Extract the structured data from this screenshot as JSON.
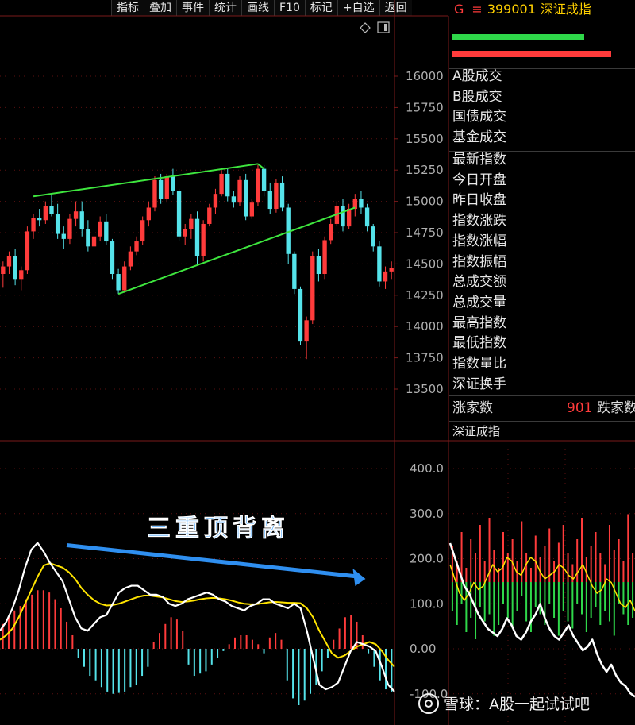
{
  "toolbar": {
    "buttons": [
      "指标",
      "叠加",
      "事件",
      "统计",
      "画线",
      "F10",
      "标记",
      "+自选",
      "返回"
    ]
  },
  "header": {
    "g": "G",
    "eq": "≡",
    "code": "399001",
    "name": "深证成指"
  },
  "sidebar": {
    "group1": [
      "A股成交",
      "B股成交",
      "国债成交",
      "基金成交"
    ],
    "group2": [
      "最新指数",
      "今日开盘",
      "昨日收盘",
      "指数涨跌",
      "指数涨幅",
      "指数振幅",
      "总成交额",
      "总成交量",
      "最高指数",
      "最低指数",
      "指数量比",
      "深证换手"
    ],
    "up_label": "涨家数",
    "up_value": "901",
    "down_label": "跌家数",
    "sub_title": "深证成指"
  },
  "annotation": "三重顶背离",
  "watermark": "雪球：A股一起试试吧",
  "colors": {
    "up": "#ff3b3b",
    "down": "#55e3ea",
    "trend": "#3ee63e",
    "dif": "#ffffff",
    "dea": "#ffe400",
    "arrow": "#2f8ff0",
    "grid": "#8b1a1a"
  },
  "chart_data": [
    {
      "type": "candlestick",
      "y_ticks": [
        16000,
        15750,
        15500,
        15250,
        15000,
        14750,
        14500,
        14250,
        14000,
        13750,
        13500
      ],
      "ylim": [
        13400,
        16200
      ],
      "ohlc": [
        [
          14420,
          14520,
          14310,
          14480
        ],
        [
          14480,
          14600,
          14420,
          14560
        ],
        [
          14560,
          14620,
          14330,
          14380
        ],
        [
          14380,
          14480,
          14290,
          14450
        ],
        [
          14450,
          14800,
          14420,
          14760
        ],
        [
          14760,
          14900,
          14700,
          14870
        ],
        [
          14870,
          14940,
          14800,
          14850
        ],
        [
          14850,
          15000,
          14820,
          14960
        ],
        [
          14960,
          15060,
          14880,
          14900
        ],
        [
          14900,
          14980,
          14700,
          14740
        ],
        [
          14740,
          14800,
          14620,
          14700
        ],
        [
          14700,
          14900,
          14660,
          14860
        ],
        [
          14860,
          15000,
          14800,
          14920
        ],
        [
          14920,
          15000,
          14720,
          14780
        ],
        [
          14780,
          14850,
          14600,
          14640
        ],
        [
          14640,
          14750,
          14560,
          14720
        ],
        [
          14720,
          14880,
          14680,
          14840
        ],
        [
          14840,
          14900,
          14650,
          14680
        ],
        [
          14680,
          14700,
          14380,
          14420
        ],
        [
          14420,
          14460,
          14260,
          14290
        ],
        [
          14290,
          14520,
          14270,
          14480
        ],
        [
          14480,
          14640,
          14450,
          14600
        ],
        [
          14600,
          14720,
          14570,
          14680
        ],
        [
          14680,
          14880,
          14650,
          14850
        ],
        [
          14850,
          15000,
          14800,
          14950
        ],
        [
          14950,
          15200,
          14920,
          15170
        ],
        [
          15170,
          15220,
          14980,
          15020
        ],
        [
          15020,
          15220,
          14990,
          15200
        ],
        [
          15200,
          15260,
          15050,
          15080
        ],
        [
          15080,
          15100,
          14680,
          14720
        ],
        [
          14720,
          14820,
          14650,
          14780
        ],
        [
          14780,
          14900,
          14700,
          14860
        ],
        [
          14860,
          14920,
          14500,
          14560
        ],
        [
          14560,
          14850,
          14520,
          14820
        ],
        [
          14820,
          14980,
          14800,
          14950
        ],
        [
          14950,
          15100,
          14900,
          15060
        ],
        [
          15060,
          15250,
          15040,
          15220
        ],
        [
          15220,
          15260,
          15000,
          15040
        ],
        [
          15040,
          15080,
          14950,
          14990
        ],
        [
          14990,
          15200,
          14960,
          15170
        ],
        [
          15170,
          15220,
          14850,
          14880
        ],
        [
          14880,
          15020,
          14860,
          14990
        ],
        [
          14990,
          15290,
          14960,
          15260
        ],
        [
          15260,
          15290,
          15040,
          15080
        ],
        [
          15080,
          15150,
          14900,
          14940
        ],
        [
          14940,
          15180,
          14910,
          15150
        ],
        [
          15150,
          15200,
          14920,
          14950
        ],
        [
          14950,
          14980,
          14500,
          14580
        ],
        [
          14580,
          14600,
          14260,
          14300
        ],
        [
          14300,
          14320,
          13850,
          13880
        ],
        [
          13880,
          14080,
          13740,
          14050
        ],
        [
          14050,
          14600,
          14020,
          14560
        ],
        [
          14560,
          14620,
          14360,
          14420
        ],
        [
          14420,
          14720,
          14380,
          14690
        ],
        [
          14690,
          14860,
          14660,
          14820
        ],
        [
          14820,
          15000,
          14800,
          14960
        ],
        [
          14960,
          15020,
          14760,
          14800
        ],
        [
          14800,
          14980,
          14780,
          14940
        ],
        [
          14940,
          15060,
          14880,
          15020
        ],
        [
          15020,
          15080,
          14900,
          14950
        ],
        [
          14950,
          14980,
          14760,
          14800
        ],
        [
          14800,
          14820,
          14600,
          14640
        ],
        [
          14640,
          14680,
          14320,
          14360
        ],
        [
          14360,
          14480,
          14300,
          14440
        ],
        [
          14440,
          14520,
          14380,
          14470
        ]
      ],
      "trendlines": [
        {
          "from": [
            5,
            15040
          ],
          "to": [
            42,
            15300
          ]
        },
        {
          "from": [
            19,
            14260
          ],
          "to": [
            58,
            14950
          ]
        },
        {
          "from": [
            42,
            15300
          ],
          "to": [
            43,
            15260
          ]
        }
      ]
    },
    {
      "type": "macd",
      "y_ticks": [
        400.0,
        300.0,
        200.0,
        100.0,
        0.0,
        -100.0
      ],
      "ylim": [
        -170,
        420
      ],
      "hist": [
        55,
        70,
        85,
        95,
        110,
        120,
        130,
        130,
        125,
        110,
        90,
        60,
        30,
        -20,
        -40,
        -60,
        -70,
        -85,
        -95,
        -100,
        -98,
        -95,
        -85,
        -80,
        -60,
        -40,
        15,
        35,
        55,
        70,
        65,
        40,
        -35,
        -60,
        -55,
        -50,
        -35,
        -20,
        -5,
        10,
        25,
        30,
        30,
        20,
        10,
        -10,
        25,
        35,
        20,
        -70,
        -110,
        -125,
        -115,
        -100,
        -80,
        -50,
        -20,
        20,
        45,
        70,
        75,
        60,
        30,
        -10,
        -40,
        -70,
        -90,
        -95
      ],
      "dif": [
        40,
        60,
        90,
        130,
        180,
        220,
        235,
        215,
        190,
        170,
        150,
        110,
        70,
        45,
        40,
        55,
        70,
        75,
        100,
        125,
        135,
        140,
        140,
        130,
        120,
        120,
        115,
        100,
        95,
        100,
        110,
        115,
        120,
        125,
        120,
        110,
        105,
        95,
        90,
        85,
        95,
        100,
        110,
        110,
        100,
        95,
        90,
        100,
        90,
        40,
        -20,
        -80,
        -90,
        -85,
        -75,
        -40,
        -5,
        15,
        10,
        5,
        -5,
        -40,
        -80,
        -95
      ],
      "dea": [
        20,
        30,
        45,
        70,
        100,
        130,
        160,
        185,
        190,
        185,
        180,
        170,
        155,
        135,
        120,
        108,
        100,
        96,
        97,
        100,
        105,
        110,
        115,
        118,
        118,
        116,
        114,
        110,
        106,
        104,
        105,
        107,
        110,
        112,
        113,
        112,
        110,
        107,
        103,
        100,
        99,
        99,
        101,
        103,
        104,
        103,
        102,
        102,
        101,
        90,
        70,
        40,
        15,
        -10,
        -20,
        -15,
        -5,
        5,
        10,
        15,
        10,
        -5,
        -25,
        -40
      ],
      "annotation_arrow": {
        "from": [
          11,
          230
        ],
        "to": [
          64,
          155
        ]
      }
    },
    {
      "type": "breadth",
      "y_zero": 150,
      "up": [
        50,
        30,
        70,
        20,
        60,
        40,
        80,
        30,
        90,
        45,
        20,
        70,
        40,
        60,
        30,
        85,
        40,
        20,
        65,
        35,
        50,
        75,
        30,
        55,
        80,
        40,
        25,
        60,
        90,
        35,
        50,
        70,
        40,
        25,
        80,
        45,
        60,
        30,
        95,
        40
      ],
      "down": [
        -40,
        -60,
        -30,
        -70,
        -50,
        -80,
        -35,
        -55,
        -45,
        -75,
        -60,
        -30,
        -50,
        -65,
        -40,
        -20,
        -55,
        -70,
        -35,
        -45,
        -60,
        -30,
        -50,
        -75,
        -40,
        -55,
        -65,
        -30,
        -45,
        -70,
        -50,
        -35,
        -60,
        -40,
        -55,
        -75,
        -30,
        -45,
        -60,
        -50
      ],
      "line_white": [
        140,
        120,
        100,
        80,
        70,
        55,
        40,
        30,
        20,
        15,
        10,
        20,
        35,
        25,
        10,
        5,
        15,
        30,
        40,
        55,
        35,
        20,
        10,
        5,
        15,
        25,
        10,
        0,
        -10,
        -5,
        5,
        -15,
        -30,
        -40,
        -30,
        -45,
        -55,
        -60,
        -70,
        -75
      ],
      "line_yellow": [
        110,
        90,
        70,
        60,
        70,
        85,
        75,
        80,
        95,
        110,
        100,
        105,
        120,
        115,
        100,
        95,
        110,
        120,
        115,
        100,
        90,
        95,
        100,
        110,
        105,
        95,
        90,
        100,
        110,
        95,
        80,
        70,
        75,
        90,
        85,
        70,
        55,
        50,
        60,
        45
      ]
    }
  ]
}
